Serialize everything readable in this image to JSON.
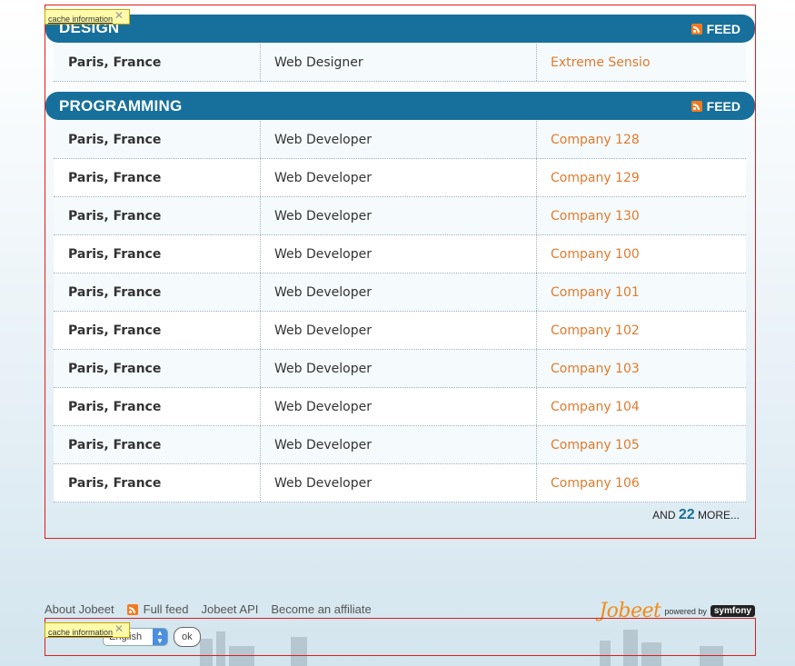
{
  "cache_tag_label": "cache information",
  "categories": [
    {
      "title": "DESIGN",
      "feed_label": "FEED",
      "jobs": [
        {
          "location": "Paris, France",
          "position": "Web Designer",
          "company": "Extreme Sensio"
        }
      ]
    },
    {
      "title": "PROGRAMMING",
      "feed_label": "FEED",
      "jobs": [
        {
          "location": "Paris, France",
          "position": "Web Developer",
          "company": "Company 128"
        },
        {
          "location": "Paris, France",
          "position": "Web Developer",
          "company": "Company 129"
        },
        {
          "location": "Paris, France",
          "position": "Web Developer",
          "company": "Company 130"
        },
        {
          "location": "Paris, France",
          "position": "Web Developer",
          "company": "Company 100"
        },
        {
          "location": "Paris, France",
          "position": "Web Developer",
          "company": "Company 101"
        },
        {
          "location": "Paris, France",
          "position": "Web Developer",
          "company": "Company 102"
        },
        {
          "location": "Paris, France",
          "position": "Web Developer",
          "company": "Company 103"
        },
        {
          "location": "Paris, France",
          "position": "Web Developer",
          "company": "Company 104"
        },
        {
          "location": "Paris, France",
          "position": "Web Developer",
          "company": "Company 105"
        },
        {
          "location": "Paris, France",
          "position": "Web Developer",
          "company": "Company 106"
        }
      ],
      "more": {
        "prefix": "AND",
        "count": "22",
        "suffix": "MORE..."
      }
    }
  ],
  "footer": {
    "links": [
      "About Jobeet",
      "Full feed",
      "Jobeet API",
      "Become an affiliate"
    ],
    "brand": "Jobeet",
    "powered_by": "powered by",
    "symfony": "symfony"
  },
  "language_form": {
    "selected": "English",
    "ok_label": "ok"
  },
  "colors": {
    "header_bg": "#17709b",
    "company_link": "#e07b2e",
    "cache_border": "#e11c1c"
  }
}
